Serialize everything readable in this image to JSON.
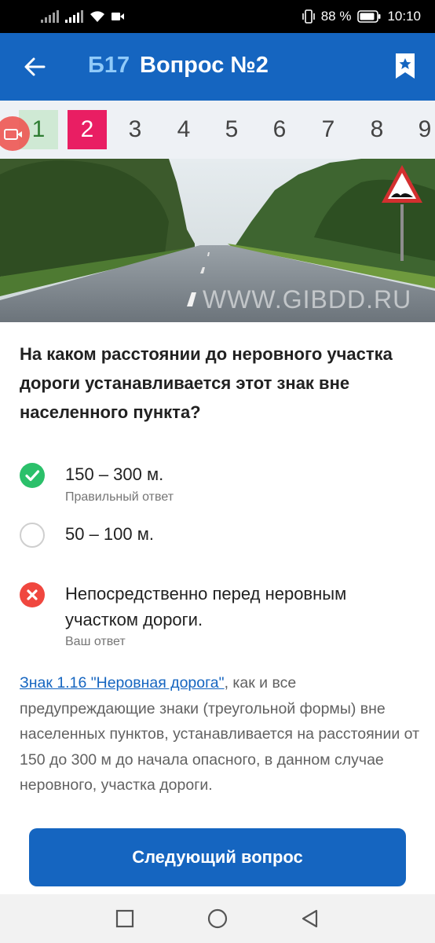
{
  "status_bar": {
    "battery": "88 %",
    "time": "10:10",
    "icons": [
      "signal-icon",
      "signal-icon",
      "wifi-icon",
      "video-icon",
      "vibrate-icon",
      "battery-icon"
    ]
  },
  "app_bar": {
    "ticket": "Б17",
    "title": "Вопрос №2",
    "icons": [
      "back-arrow-icon",
      "bookmark-star-icon"
    ]
  },
  "question_numbers": [
    "1",
    "2",
    "3",
    "4",
    "5",
    "6",
    "7",
    "8",
    "9"
  ],
  "question_states": {
    "done": "1",
    "current": "2"
  },
  "photo": {
    "watermark": "WWW.GIBDD.RU"
  },
  "question": {
    "text": "На каком расстоянии до неровного участка дороги устанавливается этот знак вне населенного пункта?"
  },
  "answers": [
    {
      "text": "150 – 300 м.",
      "note": "Правильный ответ",
      "state": "correct"
    },
    {
      "text": "50 – 100 м.",
      "note": "",
      "state": "neutral"
    },
    {
      "text": "Непосредственно перед неровным участком дороги.",
      "note": "Ваш ответ",
      "state": "wrong"
    }
  ],
  "explanation": {
    "link": "Знак 1.16 \"Неровная дорога\"",
    "text": ", как и все предупреждающие знаки (треугольной формы) вне населенных пунктов, устанавливается на расстоянии от 150 до 300 м до начала опасного, в данном случае неровного, участка дороги."
  },
  "next_button": {
    "label": "Следующий вопрос"
  },
  "colors": {
    "primary": "#1565c0",
    "current_question": "#e91e63",
    "done_question_bg": "#cfe9d4",
    "correct": "#2bc06a",
    "wrong": "#f0473f",
    "link": "#1565c0"
  }
}
